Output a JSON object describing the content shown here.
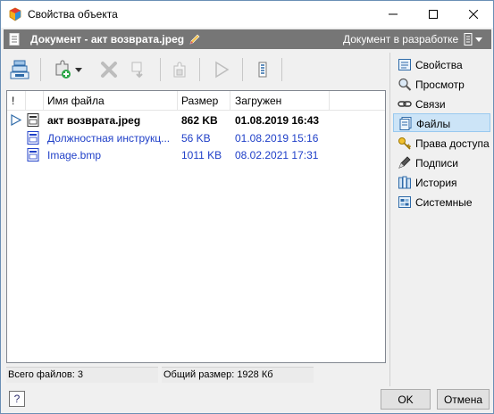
{
  "window": {
    "title": "Свойства объекта",
    "controls": {
      "minimize": "minimize",
      "maximize": "maximize",
      "close": "close"
    }
  },
  "document_bar": {
    "title": "Документ - акт возврата.jpeg",
    "status": "Документ в разработке",
    "background": "#767676"
  },
  "toolbar": {
    "buttons": [
      {
        "name": "attach-files",
        "icon": "file-stack-icon",
        "enabled": true
      },
      {
        "name": "add-file",
        "icon": "add-puzzle-icon",
        "enabled": true,
        "has_dropdown": true
      },
      {
        "name": "delete-file",
        "icon": "delete-x-icon",
        "enabled": false
      },
      {
        "name": "replace-file",
        "icon": "replace-icon",
        "enabled": false
      },
      {
        "name": "copy-file",
        "icon": "copy-puzzle-icon",
        "enabled": false
      },
      {
        "name": "set-main",
        "icon": "flag-icon",
        "enabled": false
      },
      {
        "name": "columns",
        "icon": "columns-list-icon",
        "enabled": true
      }
    ]
  },
  "files_table": {
    "columns": [
      "!",
      "Имя файла",
      "Размер",
      "Загружен"
    ],
    "rows": [
      {
        "name": "акт возврата.jpeg",
        "size": "862 KB",
        "uploaded": "01.08.2019 16:43",
        "main": true
      },
      {
        "name": "Должностная инструкц...",
        "size": "56 KB",
        "uploaded": "01.08.2019 15:16",
        "main": false
      },
      {
        "name": "Image.bmp",
        "size": "1011 KB",
        "uploaded": "08.02.2021 17:31",
        "main": false
      }
    ],
    "link_color": "#2040c8"
  },
  "status": {
    "total_files": "Всего файлов: 3",
    "total_size": "Общий размер: 1928 Кб"
  },
  "nav": {
    "selected": "Файлы",
    "items": [
      {
        "label": "Свойства",
        "icon": "properties-icon"
      },
      {
        "label": "Просмотр",
        "icon": "magnifier-icon"
      },
      {
        "label": "Связи",
        "icon": "link-chain-icon"
      },
      {
        "label": "Файлы",
        "icon": "files-icon"
      },
      {
        "label": "Права доступа",
        "icon": "key-icon"
      },
      {
        "label": "Подписи",
        "icon": "signature-pen-icon"
      },
      {
        "label": "История",
        "icon": "history-books-icon"
      },
      {
        "label": "Системные",
        "icon": "system-icon"
      }
    ]
  },
  "footer": {
    "help": "?",
    "ok": "OK",
    "cancel": "Отмена"
  }
}
